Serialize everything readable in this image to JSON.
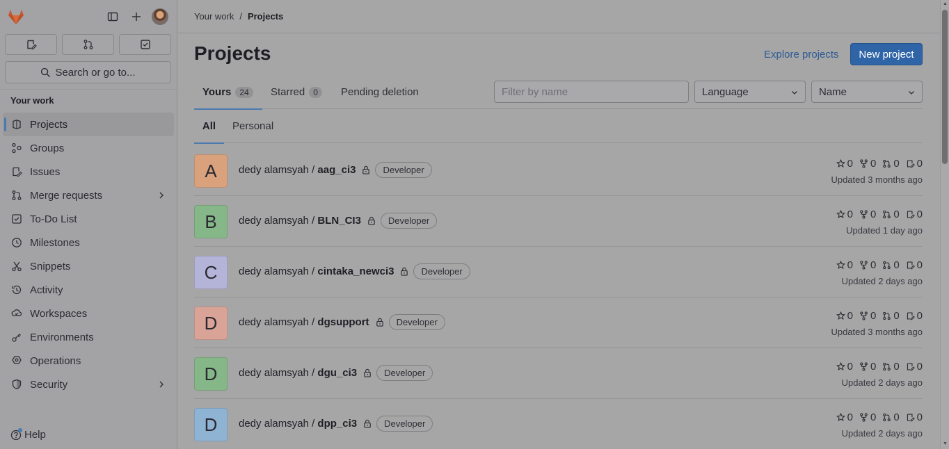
{
  "sidebar": {
    "search_label": "Search or go to...",
    "section_title": "Your work",
    "items": [
      {
        "label": "Projects",
        "icon": "project-icon"
      },
      {
        "label": "Groups",
        "icon": "group-icon"
      },
      {
        "label": "Issues",
        "icon": "issues-icon"
      },
      {
        "label": "Merge requests",
        "icon": "merge-request-icon"
      },
      {
        "label": "To-Do List",
        "icon": "todo-icon"
      },
      {
        "label": "Milestones",
        "icon": "milestone-icon"
      },
      {
        "label": "Snippets",
        "icon": "snippet-icon"
      },
      {
        "label": "Activity",
        "icon": "history-icon"
      },
      {
        "label": "Workspaces",
        "icon": "workspace-icon"
      },
      {
        "label": "Environments",
        "icon": "environment-icon"
      },
      {
        "label": "Operations",
        "icon": "operations-icon"
      },
      {
        "label": "Security",
        "icon": "shield-icon"
      }
    ],
    "help_label": "Help"
  },
  "breadcrumb": {
    "parent": "Your work",
    "current": "Projects"
  },
  "page": {
    "title": "Projects",
    "explore_label": "Explore projects",
    "new_project_label": "New project"
  },
  "tabs": [
    {
      "label": "Yours",
      "count": "24"
    },
    {
      "label": "Starred",
      "count": "0"
    },
    {
      "label": "Pending deletion"
    }
  ],
  "filters": {
    "filter_placeholder": "Filter by name",
    "language": "Language",
    "sort": "Name"
  },
  "subtabs": [
    {
      "label": "All"
    },
    {
      "label": "Personal"
    }
  ],
  "projects": [
    {
      "initial": "A",
      "color": "#d9a27d",
      "namespace": "dedy alamsyah / ",
      "name": "aag_ci3",
      "role": "Developer",
      "stars": "0",
      "forks": "0",
      "mrs": "0",
      "issues": "0",
      "updated": "Updated 3 months ago"
    },
    {
      "initial": "B",
      "color": "#86b788",
      "namespace": "dedy alamsyah / ",
      "name": "BLN_CI3",
      "role": "Developer",
      "stars": "0",
      "forks": "0",
      "mrs": "0",
      "issues": "0",
      "updated": "Updated 1 day ago"
    },
    {
      "initial": "C",
      "color": "#b4b3d8",
      "namespace": "dedy alamsyah / ",
      "name": "cintaka_newci3",
      "role": "Developer",
      "stars": "0",
      "forks": "0",
      "mrs": "0",
      "issues": "0",
      "updated": "Updated 2 days ago"
    },
    {
      "initial": "D",
      "color": "#d9a397",
      "namespace": "dedy alamsyah / ",
      "name": "dgsupport",
      "role": "Developer",
      "stars": "0",
      "forks": "0",
      "mrs": "0",
      "issues": "0",
      "updated": "Updated 3 months ago"
    },
    {
      "initial": "D",
      "color": "#86b788",
      "namespace": "dedy alamsyah / ",
      "name": "dgu_ci3",
      "role": "Developer",
      "stars": "0",
      "forks": "0",
      "mrs": "0",
      "issues": "0",
      "updated": "Updated 2 days ago"
    },
    {
      "initial": "D",
      "color": "#8fb3d3",
      "namespace": "dedy alamsyah / ",
      "name": "dpp_ci3",
      "role": "Developer",
      "stars": "0",
      "forks": "0",
      "mrs": "0",
      "issues": "0",
      "updated": "Updated 2 days ago"
    }
  ]
}
